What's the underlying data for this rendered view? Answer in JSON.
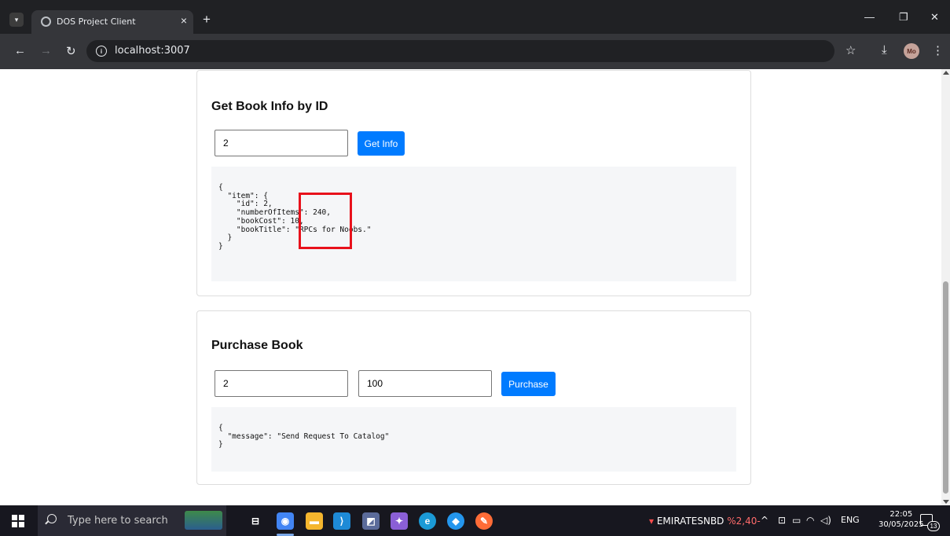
{
  "browser": {
    "tab_title": "DOS Project Client",
    "tab_close": "×",
    "new_tab": "+",
    "url": "localhost:3007"
  },
  "icons": {
    "tab_menu": "chevron-down-icon",
    "back": "arrow-left-icon",
    "forward": "arrow-right-icon",
    "reload": "reload-icon",
    "site_info": "info-icon",
    "bookmark": "star-icon",
    "download": "download-icon",
    "menu": "more-vertical-icon",
    "minimize": "minimize-icon",
    "restore": "restore-icon",
    "close": "close-icon"
  },
  "profile": {
    "initials": "Mo"
  },
  "get_info": {
    "heading": "Get Book Info by ID",
    "id_value": "2",
    "button_label": "Get Info",
    "response": "{\n  \"item\": {\n    \"id\": 2,\n    \"numberOfItems\": 240,\n    \"bookCost\": 10,\n    \"bookTitle\": \"RPCs for Noobs.\"\n  }\n}"
  },
  "purchase": {
    "heading": "Purchase Book",
    "id_value": "2",
    "amount_value": "100",
    "button_label": "Purchase",
    "response": "{\n  \"message\": \"Send Request To Catalog\"\n}"
  },
  "taskbar": {
    "search_placeholder": "Type here to search",
    "ticker_name": "EMIRATESNBD",
    "ticker_change": "%2,40-",
    "language": "ENG",
    "time": "22:05",
    "date": "30/05/2025",
    "notification_count": "13"
  },
  "colors": {
    "accent": "#007bff",
    "highlight": "#e8111b"
  }
}
